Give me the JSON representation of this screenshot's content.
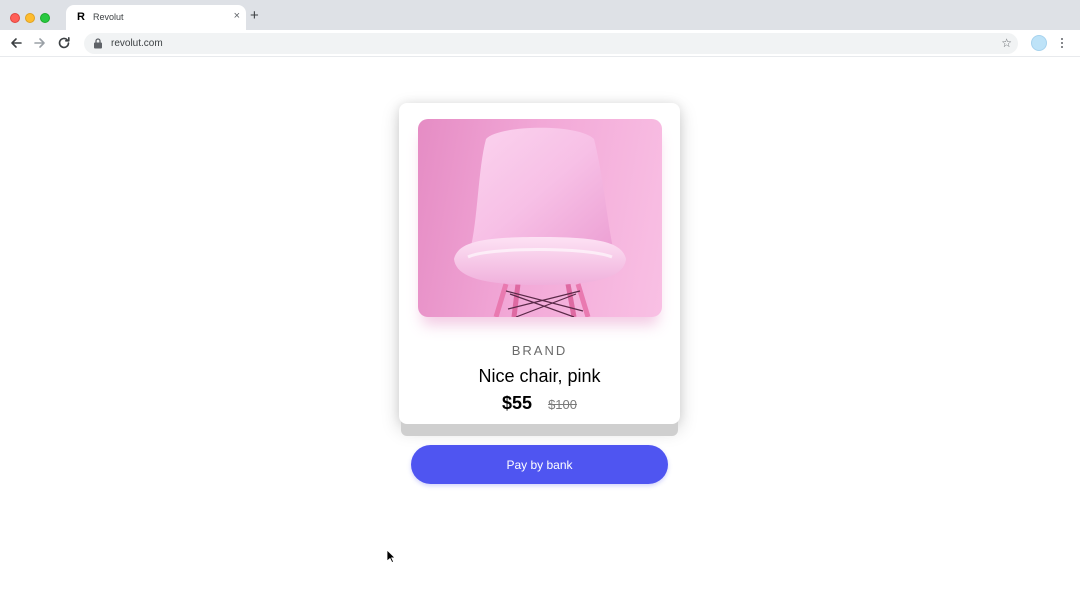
{
  "browser": {
    "tab_title": "Revolut",
    "tab_favicon": "R",
    "tab_close": "×",
    "new_tab": "+",
    "url": "revolut.com",
    "icons": [
      "back-arrow-icon",
      "forward-arrow-icon",
      "reload-icon",
      "lock-icon",
      "star-icon",
      "profile-icon",
      "kebab-menu-icon"
    ]
  },
  "product": {
    "brand": "BRAND",
    "name": "Nice chair, pink",
    "price": "$55",
    "original_price": "$100",
    "image": "pink-chair-image"
  },
  "checkout": {
    "pay_label": "Pay by bank",
    "accent_color": "#4f55f1"
  }
}
